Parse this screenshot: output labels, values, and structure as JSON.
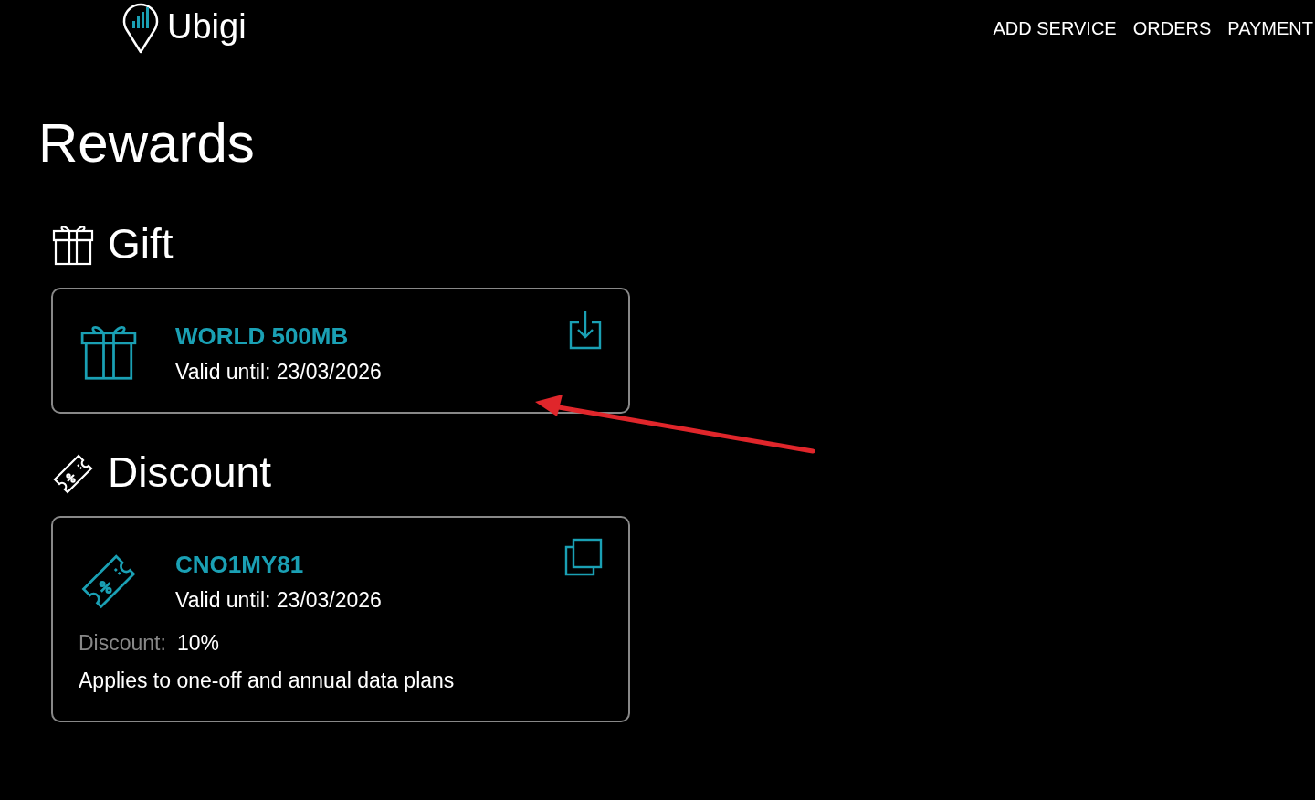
{
  "header": {
    "logo": "Ubigi",
    "nav": [
      {
        "label": "ADD SERVICE"
      },
      {
        "label": "ORDERS"
      },
      {
        "label": "PAYMENT"
      }
    ]
  },
  "title": "Rewards",
  "sections": [
    {
      "kind": "gift",
      "heading": "Gift",
      "cards": [
        {
          "name": "WORLD 500MB",
          "valid": "Valid until: 23/03/2026",
          "kind": "download"
        }
      ]
    },
    {
      "kind": "discount",
      "heading": "Discount",
      "cards": [
        {
          "name": "CNO1MY81",
          "valid": "Valid until: 23/03/2026",
          "kind": "copy",
          "discount_label": "Discount:",
          "discount_value": "10%",
          "note": "Applies to one-off and annual data plans"
        }
      ]
    }
  ]
}
